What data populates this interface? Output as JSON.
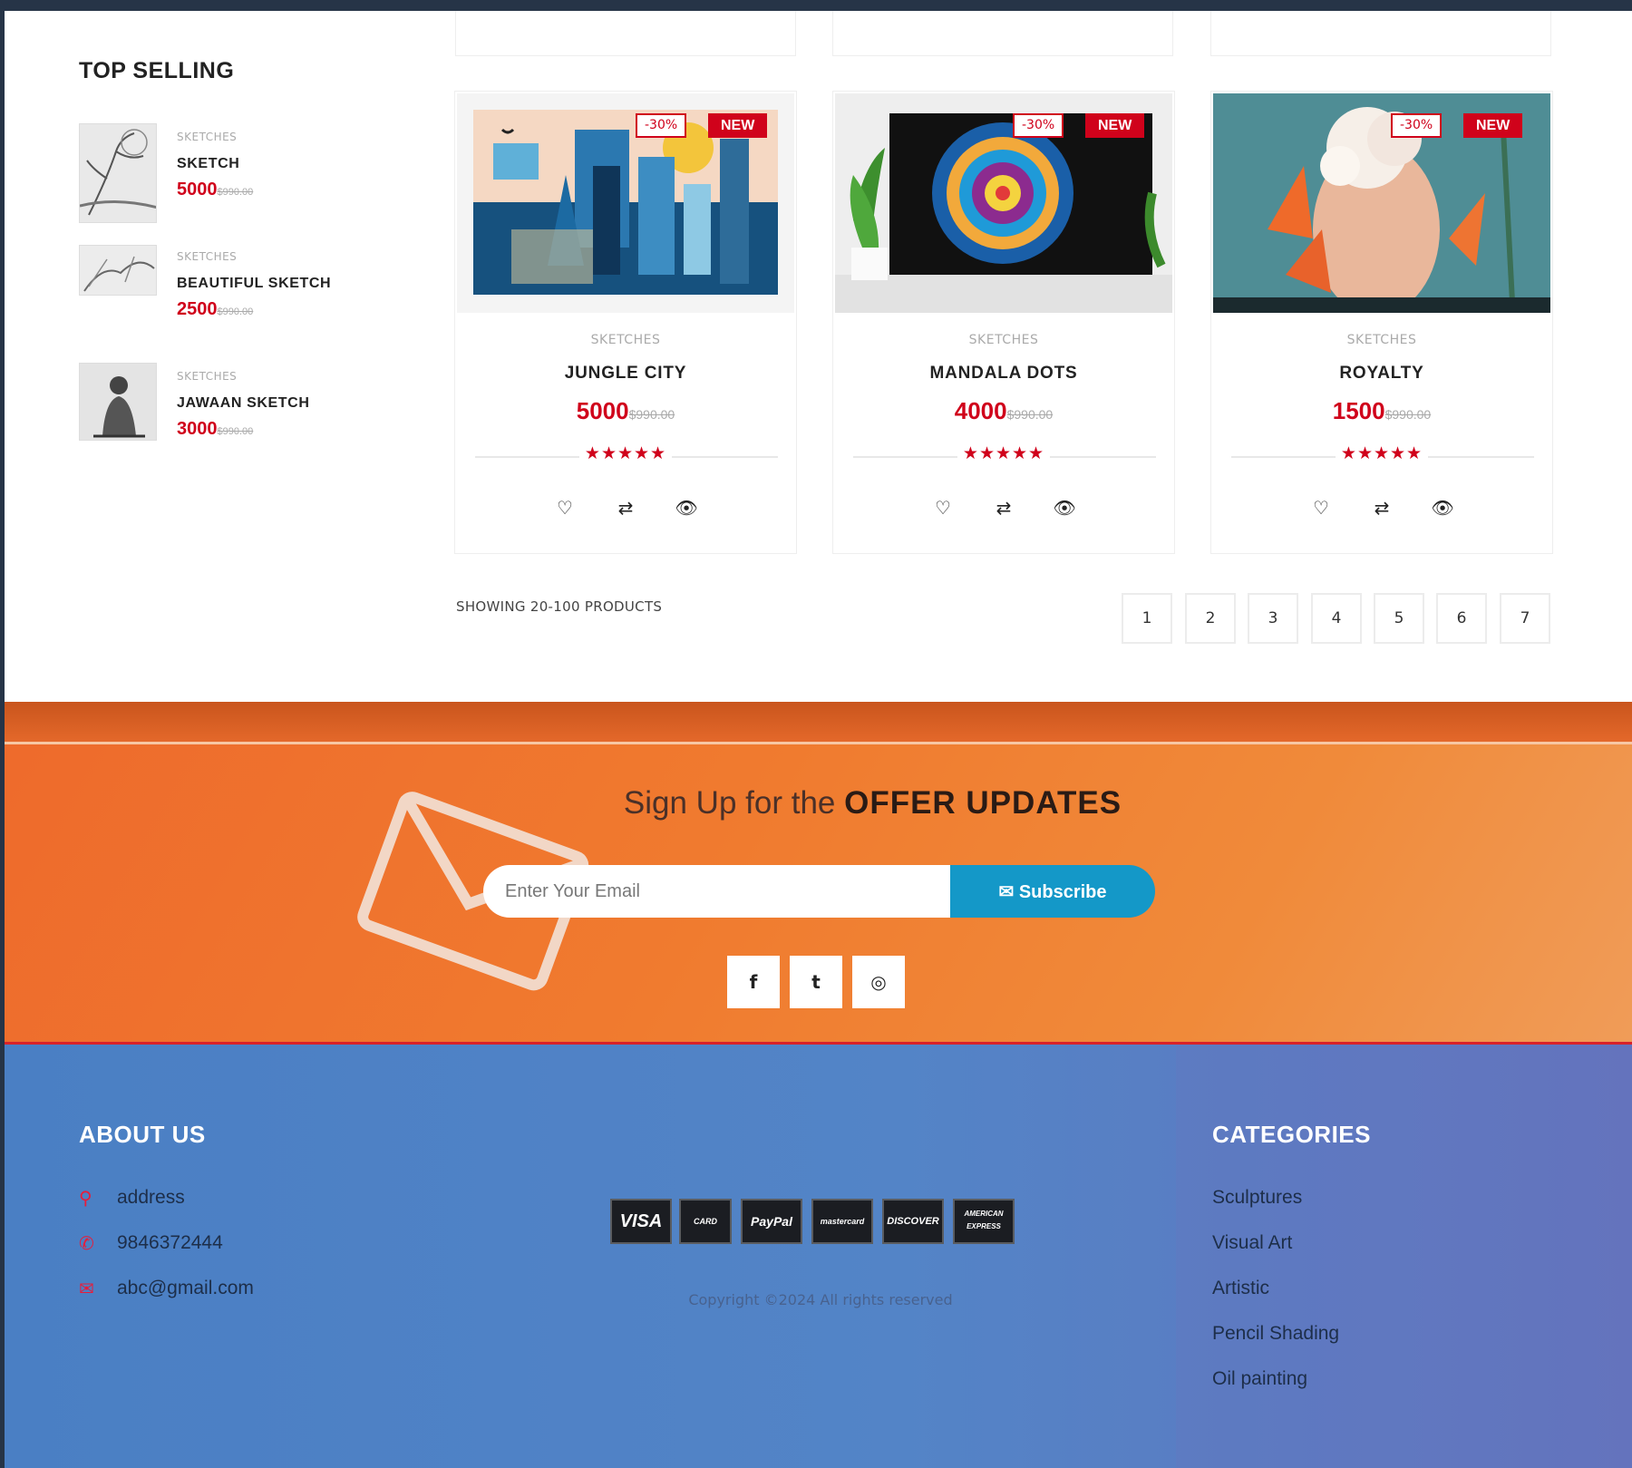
{
  "sidebar": {
    "title": "TOP SELLING",
    "items": [
      {
        "category": "SKETCHES",
        "name": "SKETCH",
        "price": "5000",
        "old_price": "$990.00"
      },
      {
        "category": "SKETCHES",
        "name": "BEAUTIFUL SKETCH",
        "price": "2500",
        "old_price": "$990.00"
      },
      {
        "category": "SKETCHES",
        "name": "JAWAAN SKETCH",
        "price": "3000",
        "old_price": "$990.00"
      }
    ]
  },
  "products": [
    {
      "category": "SKETCHES",
      "name": "JUNGLE CITY",
      "price": "5000",
      "old_price": "$990.00",
      "discount": "-30%",
      "badge": "NEW",
      "rating": "★★★★★"
    },
    {
      "category": "SKETCHES",
      "name": "MANDALA DOTS",
      "price": "4000",
      "old_price": "$990.00",
      "discount": "-30%",
      "badge": "NEW",
      "rating": "★★★★★"
    },
    {
      "category": "SKETCHES",
      "name": "ROYALTY",
      "price": "1500",
      "old_price": "$990.00",
      "discount": "-30%",
      "badge": "NEW",
      "rating": "★★★★★"
    }
  ],
  "card_icons": {
    "wishlist": "♡",
    "compare": "⇄",
    "view": "👁"
  },
  "pagination": {
    "showing": "SHOWING 20-100 PRODUCTS",
    "pages": [
      "1",
      "2",
      "3",
      "4",
      "5",
      "6",
      "7"
    ]
  },
  "signup": {
    "title_light": "Sign Up for the ",
    "title_bold": "OFFER UPDATES",
    "email_placeholder": "Enter Your Email",
    "subscribe_label": "Subscribe",
    "social": {
      "facebook": "f",
      "twitter": "t",
      "instagram": "◎"
    }
  },
  "footer": {
    "about_title": "ABOUT US",
    "address": "address",
    "phone": "9846372444",
    "email": "abc@gmail.com",
    "payments": [
      "VISA",
      "CARD",
      "PayPal",
      "mastercard",
      "DISCOVER",
      "AMERICAN EXPRESS"
    ],
    "copyright": "Copyright ©2024 All rights reserved",
    "categories_title": "CATEGORIES",
    "categories": [
      "Sculptures",
      "Visual Art",
      "Artistic",
      "Pencil Shading",
      "Oil painting"
    ]
  },
  "colors": {
    "accent_red": "#d0021b",
    "signup_orange": "#f07b2f",
    "subscribe_blue": "#1498c8",
    "footer_blue": "#4f82c6"
  }
}
